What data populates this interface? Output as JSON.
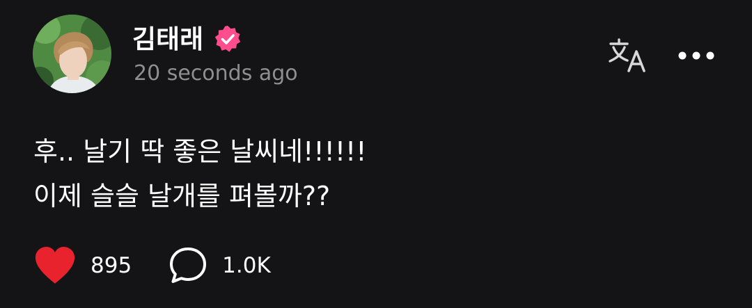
{
  "author": {
    "name": "김태래",
    "verified": true,
    "timestamp": "20 seconds ago"
  },
  "post": {
    "lines": [
      "후.. 날기 딱 좋은 날씨네!!!!!!",
      "이제 슬슬 날개를 펴볼까??"
    ]
  },
  "actions": {
    "likes": "895",
    "comments": "1.0K"
  },
  "icons": {
    "verified_badge": "verified-badge-icon",
    "translate": "translate-icon",
    "more": "more-dots-icon",
    "like": "heart-icon",
    "comment": "comment-bubble-icon"
  },
  "colors": {
    "background": "#141416",
    "text_primary": "#ffffff",
    "text_secondary": "#8e8e93",
    "verified_badge": "#ff4d8d",
    "heart": "#e8232d"
  }
}
